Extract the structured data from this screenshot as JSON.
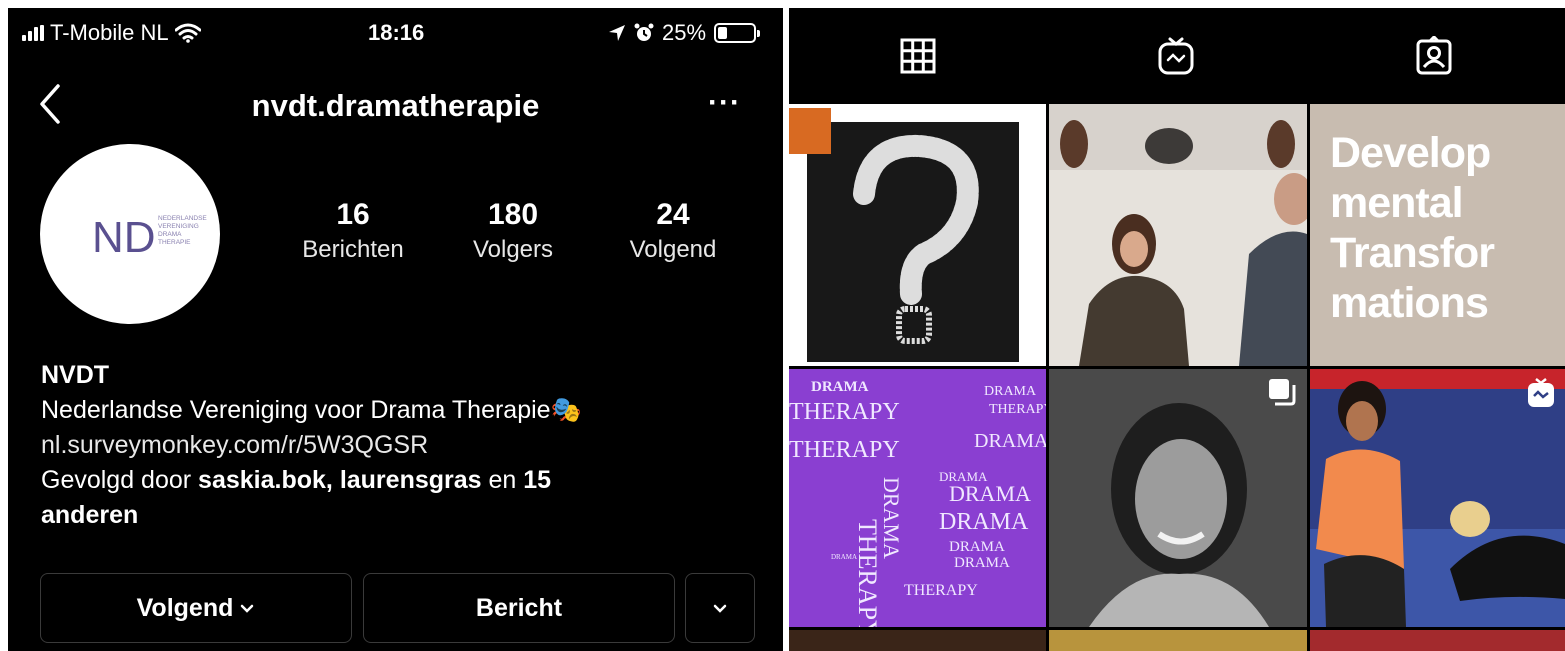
{
  "status_bar": {
    "carrier": "T-Mobile NL",
    "time": "18:16",
    "battery": "25%",
    "battery_level": 0.25
  },
  "header": {
    "username": "nvdt.dramatherapie",
    "more_label": "···"
  },
  "avatar": {
    "logo_letters": "ND",
    "logo_text": [
      "NEDERLANDSE",
      "VERENIGING",
      "DRAMA",
      "THERAPIE"
    ]
  },
  "stats": [
    {
      "value": "16",
      "label": "Berichten"
    },
    {
      "value": "180",
      "label": "Volgers"
    },
    {
      "value": "24",
      "label": "Volgend"
    }
  ],
  "bio": {
    "name": "NVDT",
    "description": "Nederlandse Vereniging voor Drama Therapie",
    "description_emoji": "🎭",
    "link": "nl.surveymonkey.com/r/5W3QGSR",
    "followed_prefix": "Gevolgd door ",
    "followed_user1": "saskia.bok",
    "followed_sep": ", ",
    "followed_user2": "laurensgras",
    "followed_mid": " en ",
    "followed_count": "15",
    "followed_suffix": " anderen"
  },
  "actions": {
    "follow_label": "Volgend",
    "message_label": "Bericht"
  },
  "tabs": [
    "grid-tab",
    "igtv-tab",
    "tagged-tab"
  ],
  "posts": {
    "dev_text": [
      "Develop",
      "mental",
      "Transfor",
      "mations"
    ],
    "drama_words": {
      "drama": "DRAMA",
      "therapy": "THERAPY"
    }
  },
  "colors": {
    "background": "#000000",
    "purple": "#8a3fd1",
    "beige": "#c8bcb0",
    "orange": "#e07020"
  }
}
